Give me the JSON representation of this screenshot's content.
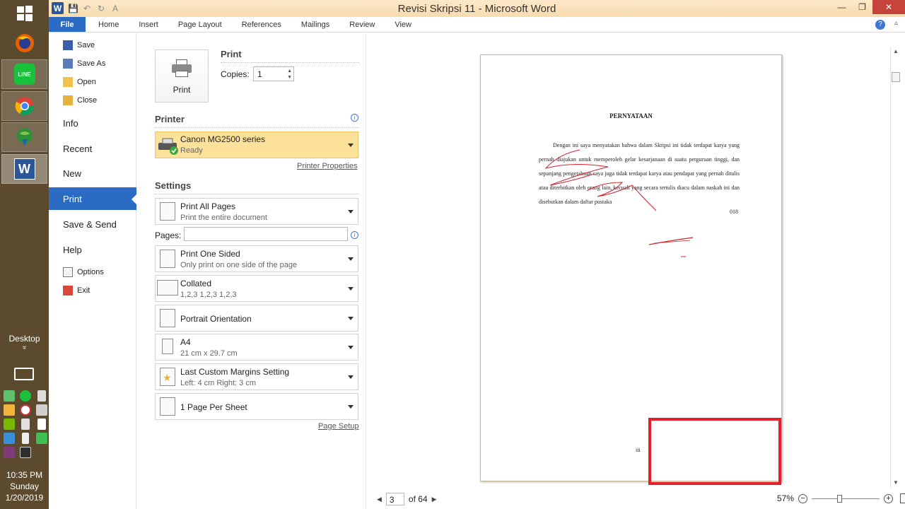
{
  "window": {
    "title": "Revisi Skripsi 11  -  Microsoft Word",
    "logo_letter": "W",
    "qat": {
      "save": "💾",
      "undo": "↶",
      "redo": "↻",
      "font": "A"
    },
    "controls": {
      "minimize": "—",
      "maximize": "❐",
      "close": "✕"
    }
  },
  "ribbon": {
    "tabs": [
      "File",
      "Home",
      "Insert",
      "Page Layout",
      "References",
      "Mailings",
      "Review",
      "View"
    ],
    "help": "?",
    "minimize": "▵"
  },
  "backstage_nav": {
    "save": "Save",
    "save_as": "Save As",
    "open": "Open",
    "close": "Close",
    "info": "Info",
    "recent": "Recent",
    "new": "New",
    "print": "Print",
    "save_send": "Save & Send",
    "help": "Help",
    "options": "Options",
    "exit": "Exit"
  },
  "print": {
    "button_label": "Print",
    "heading": "Print",
    "copies_label": "Copies:",
    "copies_value": "1",
    "printer_heading": "Printer",
    "printer_name": "Canon MG2500 series",
    "printer_status": "Ready",
    "printer_properties": "Printer Properties",
    "settings_heading": "Settings",
    "range_title": "Print All Pages",
    "range_sub": "Print the entire document",
    "pages_label": "Pages:",
    "pages_value": "",
    "sides_title": "Print One Sided",
    "sides_sub": "Only print on one side of the page",
    "collate_title": "Collated",
    "collate_sub": "1,2,3    1,2,3    1,2,3",
    "orientation": "Portrait Orientation",
    "paper_title": "A4",
    "paper_sub": "21 cm x 29.7 cm",
    "margins_title": "Last Custom Margins Setting",
    "margins_sub": "Left:  4 cm    Right:  3 cm",
    "per_sheet": "1 Page Per Sheet",
    "page_setup": "Page Setup",
    "info_icon": "i"
  },
  "document": {
    "title": "PERNYATAAN",
    "paragraph": "Dengan ini saya menyatakan bahwa dalam Skripsi ini tidak terdapat karya yang pernah diajukan untuk memperoleh gelar kesarjanaan di suatu perguruan tinggi, dan sepanjang pengetahuan saya juga tidak terdapat karya atau pendapat yang pernah ditulis atau diterbitkan oleh orang lain, kecuali yang secara tertulis diacu dalam naskah ini dan disebutkan dalam daftar pustaka",
    "fragment": "018",
    "page_number": "iii"
  },
  "statusbar": {
    "current_page": "3",
    "of_pages": "of 64",
    "zoom": "57%",
    "zoom_out": "−",
    "zoom_in": "+",
    "prev": "◀",
    "next": "▶"
  },
  "taskbar": {
    "desktop_label": "Desktop",
    "desktop_chevron": "»",
    "time": "10:35 PM",
    "day": "Sunday",
    "date": "1/20/2019",
    "line_label": "LINE",
    "word_label": "W"
  },
  "colors": {
    "word_blue": "#2b6bc4",
    "printer_highlight": "#fce19a",
    "taskbar": "#5b4a2e",
    "annotation_red": "#e5202a"
  }
}
